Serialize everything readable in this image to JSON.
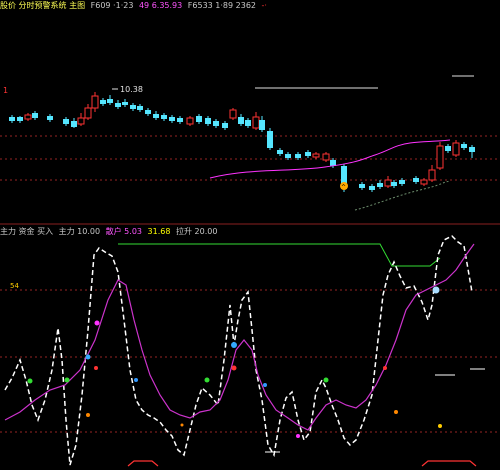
{
  "top_header": {
    "title": "股价 分时预警系统 主图",
    "items": [
      {
        "text": "F609 ·1·23",
        "color": "#c8c8c8"
      },
      {
        "text": "49 6.35.93",
        "color": "#ff55ff"
      },
      {
        "text": "F6533 1·89 2362",
        "color": "#c8c8c8"
      },
      {
        "text": "-·",
        "color": "#ff3030"
      }
    ]
  },
  "price_label": "10.38",
  "top_axis_mark": "1",
  "bottom_header": {
    "title": "主力 资金 买入",
    "items": [
      {
        "text": "主力 10.00",
        "color": "#c8c8c8"
      },
      {
        "text": "散户 5.03",
        "color": "#ff55ff"
      },
      {
        "text": "31.68",
        "color": "#ffff00"
      },
      {
        "text": "拉升 20.00",
        "color": "#c8c8c8"
      }
    ]
  },
  "bottom_axis_mark": "54",
  "colors": {
    "bull": "#ff3333",
    "bear": "#55e6ff",
    "ma": "#ff33ff",
    "grid": "#c83232",
    "white_line": "#ffffff",
    "green_line": "#33dd33",
    "magenta_line": "#cc33cc"
  }
}
